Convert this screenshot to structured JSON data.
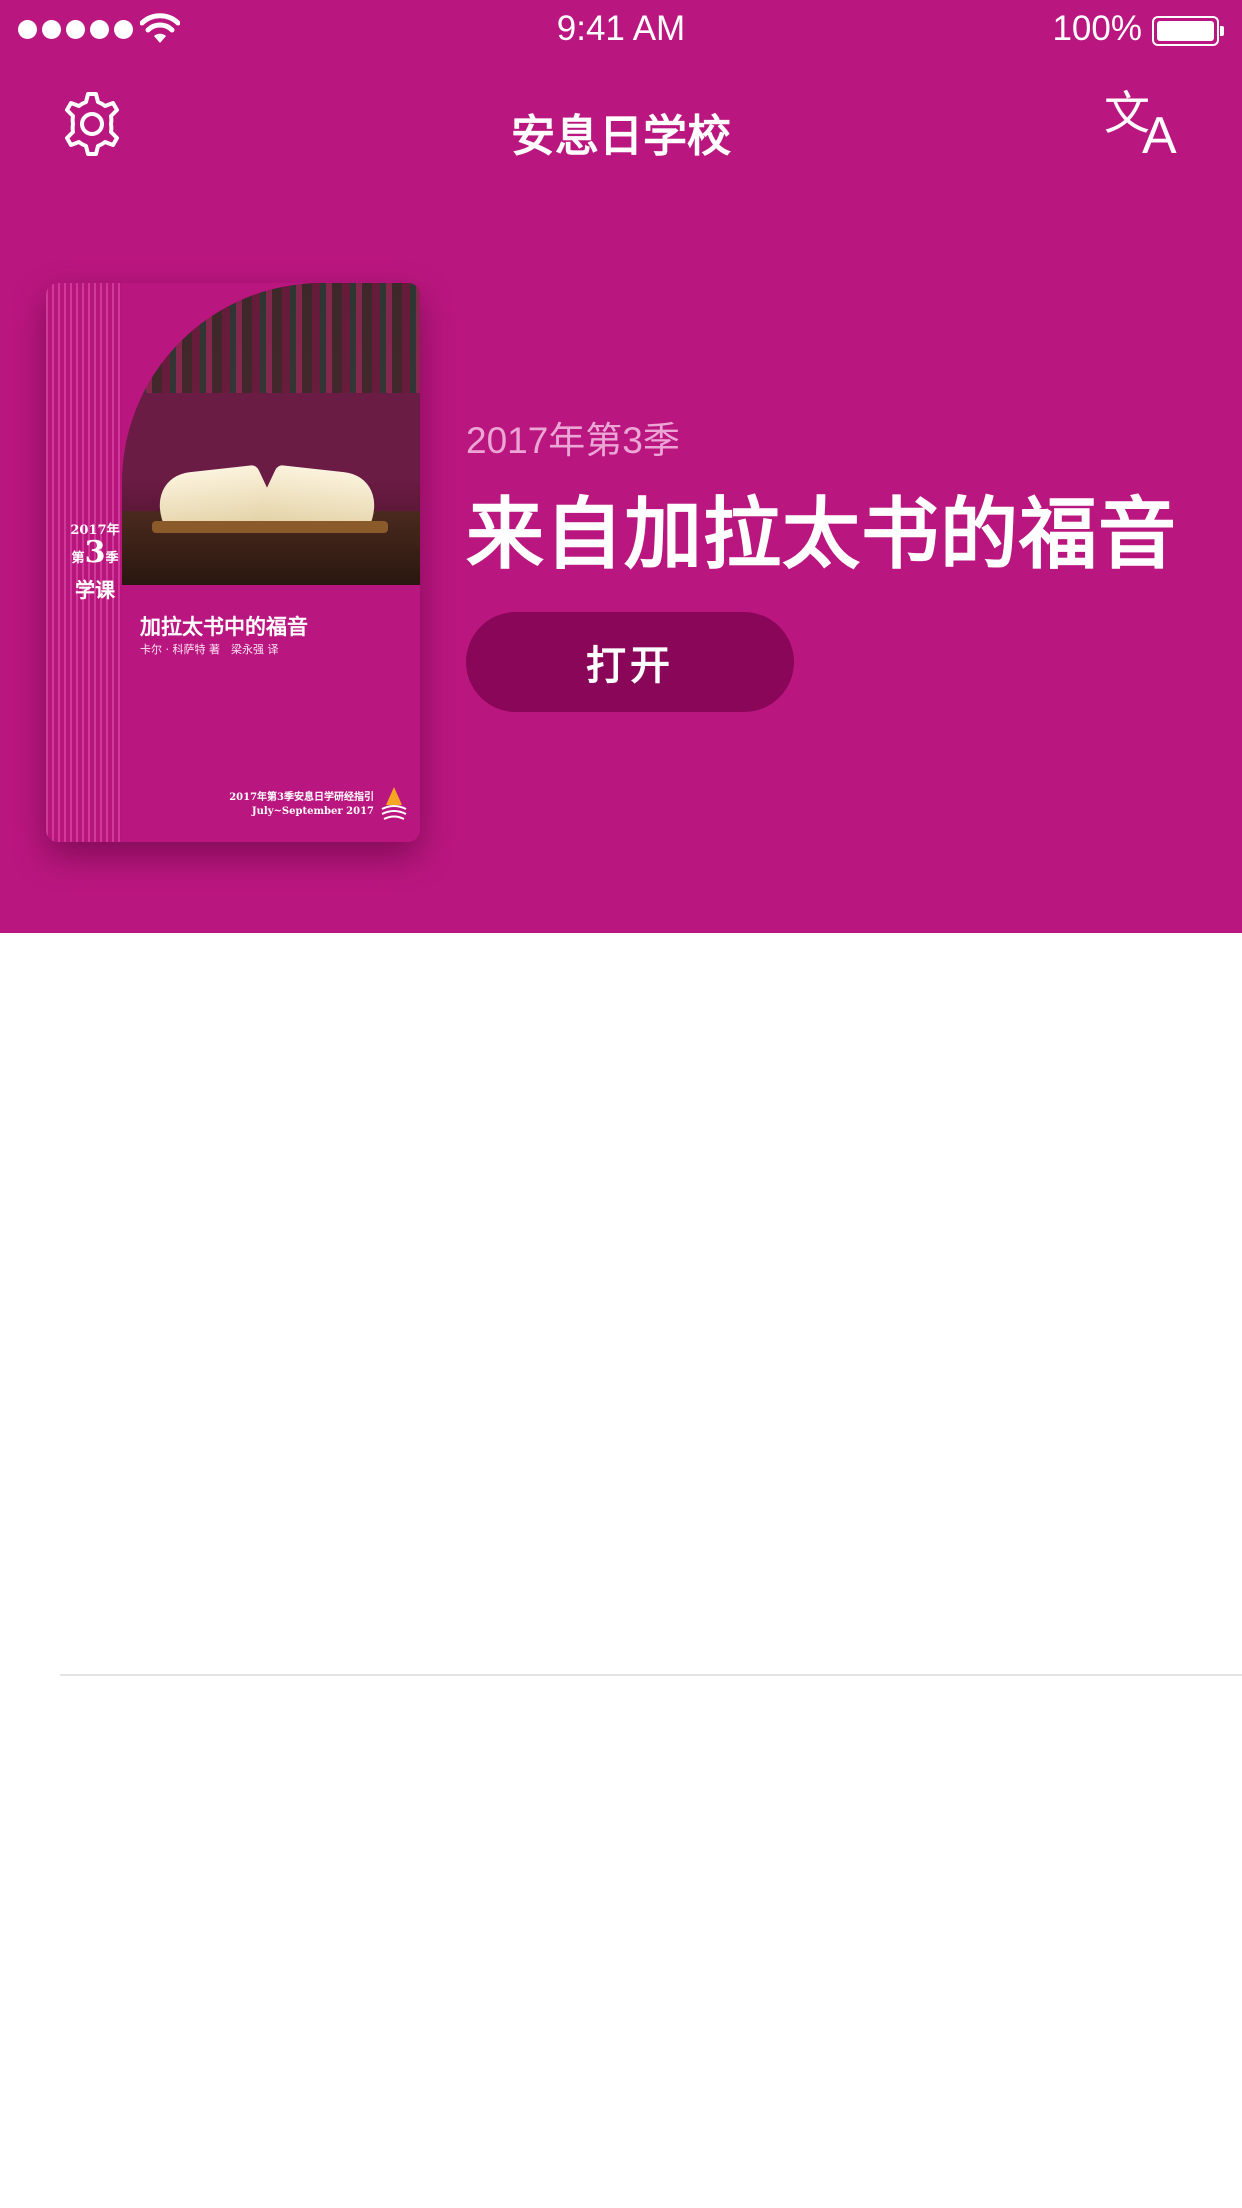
{
  "status_bar": {
    "time": "9:41 AM",
    "battery": "100%",
    "signal_bars": 5
  },
  "nav": {
    "title": "安息日学校",
    "settings_icon": "gear-icon",
    "translate_icon": "translate-icon",
    "translate_glyph_zh": "文",
    "translate_glyph_en": "A"
  },
  "cover": {
    "year": "2017",
    "year_char": "年",
    "quarter_prefix": "第",
    "quarter_num": "3",
    "quarter_char": "季",
    "lesson_word": "学课",
    "title": "加拉太书中的福音",
    "author": "卡尔 · 科萨特 著　梁永强 译",
    "footer_line1": "2017年第3季安息日学研经指引",
    "footer_line2": "July~September 2017"
  },
  "lesson": {
    "quarter_label": "2017年第3季",
    "title": "来自加拉太书的福音",
    "open_label": "打开"
  },
  "colors": {
    "brand": "#BA167F",
    "button": "#8A0658",
    "quarter_text": "#ECA6D5"
  }
}
